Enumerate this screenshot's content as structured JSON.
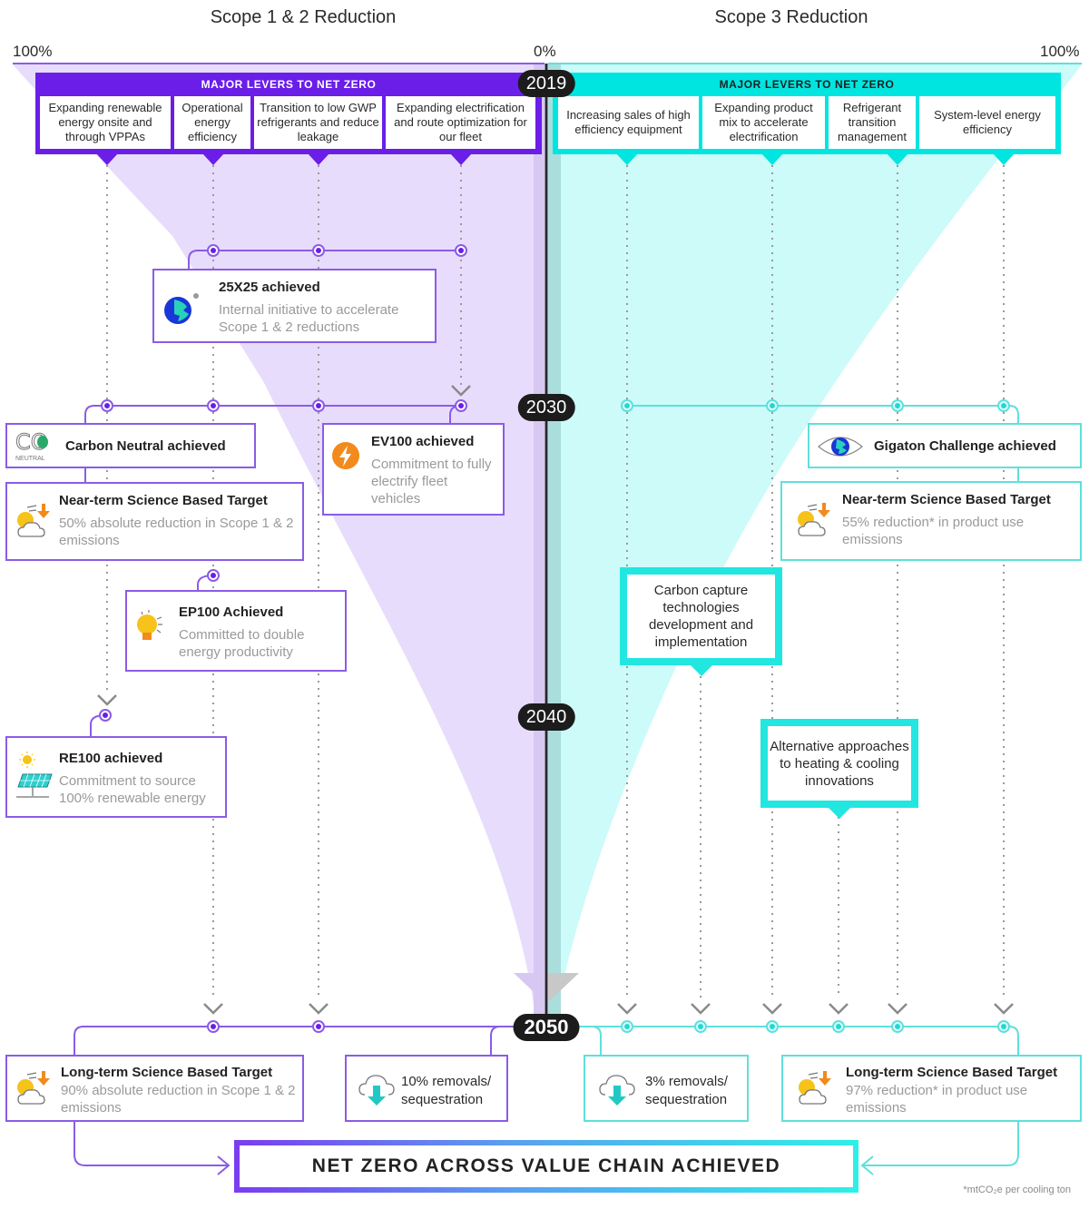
{
  "headers": {
    "scope12_title": "Scope 1 & 2 Reduction",
    "scope3_title": "Scope 3 Reduction",
    "scope12_start_pct": "100%",
    "center_pct": "0%",
    "scope3_start_pct": "100%"
  },
  "years": [
    "2019",
    "2030",
    "2040",
    "2050"
  ],
  "colors": {
    "scope12_accent": "#6a1ee8",
    "scope12_fill": "#e8dcfc",
    "scope3_accent": "#00e5e0",
    "scope3_fill": "#ccfbf9",
    "year_badge": "#1c1c1c"
  },
  "scope12_levers": {
    "heading": "MAJOR LEVERS TO NET ZERO",
    "items": [
      "Expanding renewable energy onsite and through VPPAs",
      "Operational energy efficiency",
      "Transition to low GWP refrigerants and reduce leakage",
      "Expanding electrification and route optimization for our fleet"
    ]
  },
  "scope3_levers": {
    "heading": "MAJOR LEVERS TO NET ZERO",
    "items": [
      "Increasing sales of high efficiency equipment",
      "Expanding product mix to accelerate electrification",
      "Refrigerant transition management",
      "System-level energy efficiency"
    ]
  },
  "milestones": {
    "m25x25": {
      "title": "25X25 achieved",
      "desc": "Internal initiative to accelerate Scope 1 & 2 reductions",
      "icon": "globe-icon"
    },
    "carbon_neutral": {
      "title": "Carbon Neutral achieved",
      "icon": "co2-neutral-icon",
      "icon_label": "NEUTRAL"
    },
    "ev100": {
      "title": "EV100 achieved",
      "desc": "Commitment to fully electrify fleet vehicles",
      "icon": "lightning-icon"
    },
    "near_term_12": {
      "title": "Near-term Science Based Target",
      "desc": "50% absolute reduction in Scope 1 & 2 emissions",
      "icon": "sun-cloud-down-icon"
    },
    "ep100": {
      "title": "EP100 Achieved",
      "desc": "Committed to double energy productivity",
      "icon": "lightbulb-icon"
    },
    "re100": {
      "title": "RE100 achieved",
      "desc": "Commitment to source 100% renewable energy",
      "icon": "solar-panel-icon"
    },
    "gigaton": {
      "title": "Gigaton Challenge achieved",
      "icon": "eye-globe-icon"
    },
    "near_term_3": {
      "title": "Near-term Science Based Target",
      "desc": "55% reduction* in product use emissions",
      "icon": "sun-cloud-down-icon"
    },
    "carbon_capture": {
      "text": "Carbon capture technologies development and implementation"
    },
    "alt_heating": {
      "text": "Alternative approaches to heating & cooling innovations"
    },
    "long_term_12": {
      "title": "Long-term Science Based Target",
      "desc": "90% absolute reduction in Scope 1 & 2 emissions",
      "icon": "sun-cloud-down-icon"
    },
    "removals_12": {
      "text": "10% removals/ sequestration",
      "icon": "cloud-download-icon"
    },
    "removals_3": {
      "text": "3% removals/ sequestration",
      "icon": "cloud-download-icon"
    },
    "long_term_3": {
      "title": "Long-term Science Based Target",
      "desc": "97% reduction* in product use emissions",
      "icon": "sun-cloud-down-icon"
    }
  },
  "net_zero": "NET ZERO ACROSS VALUE CHAIN ACHIEVED",
  "footnote": "*mtCO₂e per cooling ton"
}
